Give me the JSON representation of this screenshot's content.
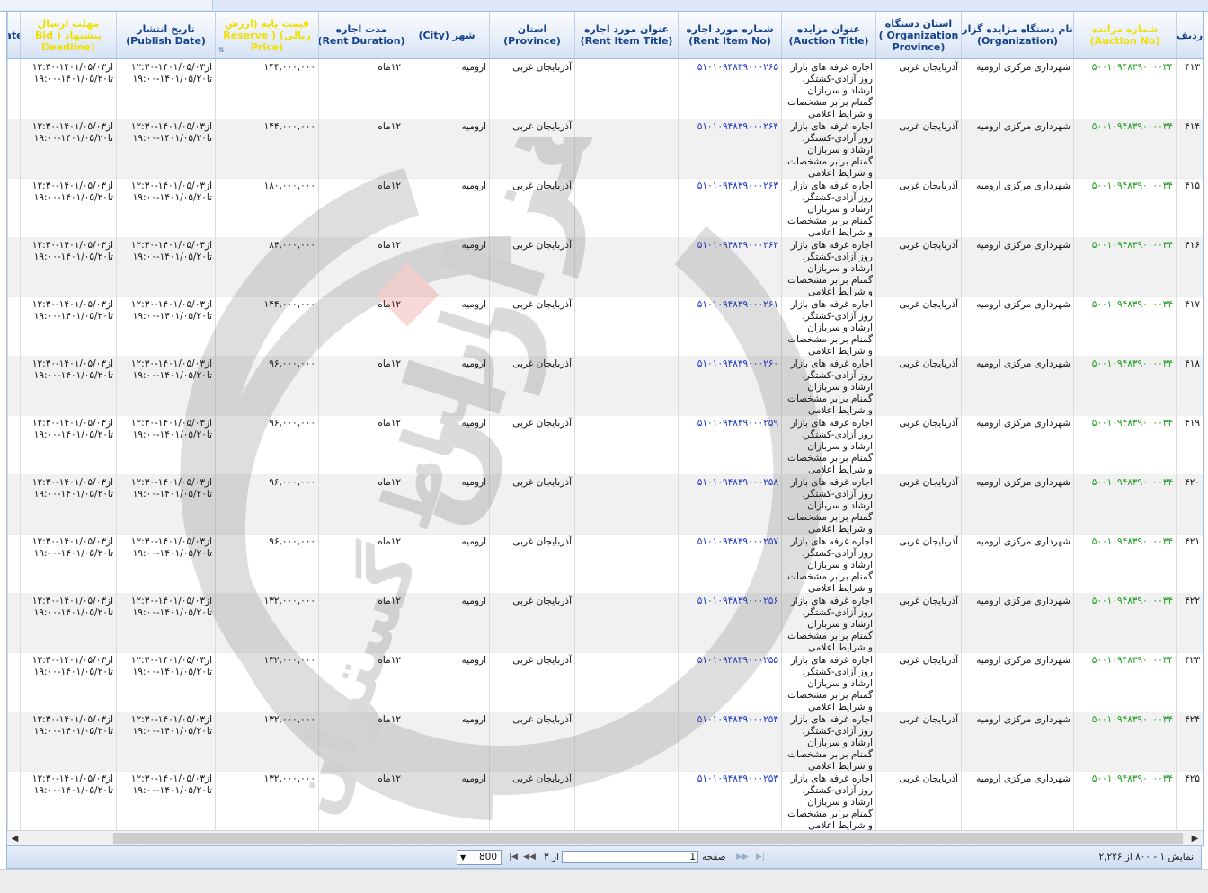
{
  "headers": [
    {
      "key": "idx",
      "lines": [
        "ردیف"
      ],
      "hl": false
    },
    {
      "key": "auction_no",
      "lines": [
        "شماره مزایده",
        "(Auction No)"
      ],
      "hl": true
    },
    {
      "key": "organization",
      "lines": [
        "نام دستگاه مزایده گزار",
        "(Organization)"
      ],
      "hl": false
    },
    {
      "key": "org_province",
      "lines": [
        "استان دستگاه",
        "Organization )",
        "(Province"
      ],
      "hl": false
    },
    {
      "key": "auction_title",
      "lines": [
        "عنوان مزایده",
        "(Auction Title)"
      ],
      "hl": false
    },
    {
      "key": "rent_item_no",
      "lines": [
        "شماره مورد اجاره",
        "(Rent Item No)"
      ],
      "hl": false
    },
    {
      "key": "rent_item_title",
      "lines": [
        "عنوان مورد اجاره",
        "(Rent Item Title)"
      ],
      "hl": false
    },
    {
      "key": "province",
      "lines": [
        "استان",
        "(Province)"
      ],
      "hl": false
    },
    {
      "key": "city",
      "lines": [
        "شهر (City)"
      ],
      "hl": false
    },
    {
      "key": "rent_duration",
      "lines": [
        "مدت اجاره",
        "(Rent Duration)"
      ],
      "hl": false
    },
    {
      "key": "reserve_price",
      "lines": [
        "قیمت پایه (ارزش",
        "ریالی) ( Reserve",
        "(Price"
      ],
      "hl": true
    },
    {
      "key": "publish_date",
      "lines": [
        "تاریخ انتشار",
        "(Publish Date)"
      ],
      "hl": false
    },
    {
      "key": "deadline",
      "lines": [
        "مهلت ارسال",
        "پیشنهاد ( Bid",
        "(Deadline"
      ],
      "hl": true
    },
    {
      "key": "extra",
      "lines": [
        "ate"
      ],
      "hl": false
    }
  ],
  "rows": [
    {
      "idx": "۴۱۳",
      "auction_no": "۵۰۰۱۰۹۴۸۳۹۰۰۰۰۳۴",
      "organization": "شهرداری مرکزی ارومیه",
      "org_province": "آذربایجان غربی",
      "auction_title": "اجاره غرفه های بازار روز آزادی-کشتگر، ارشاد و سربازان گمنام برابر مشخصات و شرایط اعلامی",
      "rent_item_no": "۵۱۰۱۰۹۴۸۳۹۰۰۰۲۶۵",
      "rent_item_title": "",
      "province": "آذربایجان غربی",
      "city": "ارومیه",
      "rent_duration": "۱۲ماه",
      "reserve_price": "۱۴۴,۰۰۰,۰۰۰",
      "publish_date": [
        "از۱۴۰۱/۰۵/۰۳-۱۲:۳۰",
        "تا۱۴۰۱/۰۵/۲۰-۱۹:۰۰"
      ],
      "deadline": [
        "از۱۴۰۱/۰۵/۰۳-۱۲:۳۰",
        "تا۱۴۰۱/۰۵/۲۰-۱۹:۰۰"
      ]
    },
    {
      "idx": "۴۱۴",
      "auction_no": "۵۰۰۱۰۹۴۸۳۹۰۰۰۰۳۴",
      "organization": "شهرداری مرکزی ارومیه",
      "org_province": "آذربایجان غربی",
      "auction_title": "اجاره غرفه های بازار روز آزادی-کشتگر، ارشاد و سربازان گمنام برابر مشخصات و شرایط اعلامی",
      "rent_item_no": "۵۱۰۱۰۹۴۸۳۹۰۰۰۲۶۴",
      "rent_item_title": "",
      "province": "آذربایجان غربی",
      "city": "ارومیه",
      "rent_duration": "۱۲ماه",
      "reserve_price": "۱۴۴,۰۰۰,۰۰۰",
      "publish_date": [
        "از۱۴۰۱/۰۵/۰۳-۱۲:۳۰",
        "تا۱۴۰۱/۰۵/۲۰-۱۹:۰۰"
      ],
      "deadline": [
        "از۱۴۰۱/۰۵/۰۳-۱۲:۳۰",
        "تا۱۴۰۱/۰۵/۲۰-۱۹:۰۰"
      ]
    },
    {
      "idx": "۴۱۵",
      "auction_no": "۵۰۰۱۰۹۴۸۳۹۰۰۰۰۳۴",
      "organization": "شهرداری مرکزی ارومیه",
      "org_province": "آذربایجان غربی",
      "auction_title": "اجاره غرفه های بازار روز آزادی-کشتگر، ارشاد و سربازان گمنام برابر مشخصات و شرایط اعلامی",
      "rent_item_no": "۵۱۰۱۰۹۴۸۳۹۰۰۰۲۶۳",
      "rent_item_title": "",
      "province": "آذربایجان غربی",
      "city": "ارومیه",
      "rent_duration": "۱۲ماه",
      "reserve_price": "۱۸۰,۰۰۰,۰۰۰",
      "publish_date": [
        "از۱۴۰۱/۰۵/۰۳-۱۲:۳۰",
        "تا۱۴۰۱/۰۵/۲۰-۱۹:۰۰"
      ],
      "deadline": [
        "از۱۴۰۱/۰۵/۰۳-۱۲:۳۰",
        "تا۱۴۰۱/۰۵/۲۰-۱۹:۰۰"
      ]
    },
    {
      "idx": "۴۱۶",
      "auction_no": "۵۰۰۱۰۹۴۸۳۹۰۰۰۰۳۴",
      "organization": "شهرداری مرکزی ارومیه",
      "org_province": "آذربایجان غربی",
      "auction_title": "اجاره غرفه های بازار روز آزادی-کشتگر، ارشاد و سربازان گمنام برابر مشخصات و شرایط اعلامی",
      "rent_item_no": "۵۱۰۱۰۹۴۸۳۹۰۰۰۲۶۲",
      "rent_item_title": "",
      "province": "آذربایجان غربی",
      "city": "ارومیه",
      "rent_duration": "۱۲ماه",
      "reserve_price": "۸۴,۰۰۰,۰۰۰",
      "publish_date": [
        "از۱۴۰۱/۰۵/۰۳-۱۲:۳۰",
        "تا۱۴۰۱/۰۵/۲۰-۱۹:۰۰"
      ],
      "deadline": [
        "از۱۴۰۱/۰۵/۰۳-۱۲:۳۰",
        "تا۱۴۰۱/۰۵/۲۰-۱۹:۰۰"
      ]
    },
    {
      "idx": "۴۱۷",
      "auction_no": "۵۰۰۱۰۹۴۸۳۹۰۰۰۰۳۴",
      "organization": "شهرداری مرکزی ارومیه",
      "org_province": "آذربایجان غربی",
      "auction_title": "اجاره غرفه های بازار روز آزادی-کشتگر، ارشاد و سربازان گمنام برابر مشخصات و شرایط اعلامی",
      "rent_item_no": "۵۱۰۱۰۹۴۸۳۹۰۰۰۲۶۱",
      "rent_item_title": "",
      "province": "آذربایجان غربی",
      "city": "ارومیه",
      "rent_duration": "۱۲ماه",
      "reserve_price": "۱۴۴,۰۰۰,۰۰۰",
      "publish_date": [
        "از۱۴۰۱/۰۵/۰۳-۱۲:۳۰",
        "تا۱۴۰۱/۰۵/۲۰-۱۹:۰۰"
      ],
      "deadline": [
        "از۱۴۰۱/۰۵/۰۳-۱۲:۳۰",
        "تا۱۴۰۱/۰۵/۲۰-۱۹:۰۰"
      ]
    },
    {
      "idx": "۴۱۸",
      "auction_no": "۵۰۰۱۰۹۴۸۳۹۰۰۰۰۳۴",
      "organization": "شهرداری مرکزی ارومیه",
      "org_province": "آذربایجان غربی",
      "auction_title": "اجاره غرفه های بازار روز آزادی-کشتگر، ارشاد و سربازان گمنام برابر مشخصات و شرایط اعلامی",
      "rent_item_no": "۵۱۰۱۰۹۴۸۳۹۰۰۰۲۶۰",
      "rent_item_title": "",
      "province": "آذربایجان غربی",
      "city": "ارومیه",
      "rent_duration": "۱۲ماه",
      "reserve_price": "۹۶,۰۰۰,۰۰۰",
      "publish_date": [
        "از۱۴۰۱/۰۵/۰۳-۱۲:۳۰",
        "تا۱۴۰۱/۰۵/۲۰-۱۹:۰۰"
      ],
      "deadline": [
        "از۱۴۰۱/۰۵/۰۳-۱۲:۳۰",
        "تا۱۴۰۱/۰۵/۲۰-۱۹:۰۰"
      ]
    },
    {
      "idx": "۴۱۹",
      "auction_no": "۵۰۰۱۰۹۴۸۳۹۰۰۰۰۳۴",
      "organization": "شهرداری مرکزی ارومیه",
      "org_province": "آذربایجان غربی",
      "auction_title": "اجاره غرفه های بازار روز آزادی-کشتگر، ارشاد و سربازان گمنام برابر مشخصات و شرایط اعلامی",
      "rent_item_no": "۵۱۰۱۰۹۴۸۳۹۰۰۰۲۵۹",
      "rent_item_title": "",
      "province": "آذربایجان غربی",
      "city": "ارومیه",
      "rent_duration": "۱۲ماه",
      "reserve_price": "۹۶,۰۰۰,۰۰۰",
      "publish_date": [
        "از۱۴۰۱/۰۵/۰۳-۱۲:۳۰",
        "تا۱۴۰۱/۰۵/۲۰-۱۹:۰۰"
      ],
      "deadline": [
        "از۱۴۰۱/۰۵/۰۳-۱۲:۳۰",
        "تا۱۴۰۱/۰۵/۲۰-۱۹:۰۰"
      ]
    },
    {
      "idx": "۴۲۰",
      "auction_no": "۵۰۰۱۰۹۴۸۳۹۰۰۰۰۳۴",
      "organization": "شهرداری مرکزی ارومیه",
      "org_province": "آذربایجان غربی",
      "auction_title": "اجاره غرفه های بازار روز آزادی-کشتگر، ارشاد و سربازان گمنام برابر مشخصات و شرایط اعلامی",
      "rent_item_no": "۵۱۰۱۰۹۴۸۳۹۰۰۰۲۵۸",
      "rent_item_title": "",
      "province": "آذربایجان غربی",
      "city": "ارومیه",
      "rent_duration": "۱۲ماه",
      "reserve_price": "۹۶,۰۰۰,۰۰۰",
      "publish_date": [
        "از۱۴۰۱/۰۵/۰۳-۱۲:۳۰",
        "تا۱۴۰۱/۰۵/۲۰-۱۹:۰۰"
      ],
      "deadline": [
        "از۱۴۰۱/۰۵/۰۳-۱۲:۳۰",
        "تا۱۴۰۱/۰۵/۲۰-۱۹:۰۰"
      ]
    },
    {
      "idx": "۴۲۱",
      "auction_no": "۵۰۰۱۰۹۴۸۳۹۰۰۰۰۳۴",
      "organization": "شهرداری مرکزی ارومیه",
      "org_province": "آذربایجان غربی",
      "auction_title": "اجاره غرفه های بازار روز آزادی-کشتگر، ارشاد و سربازان گمنام برابر مشخصات و شرایط اعلامی",
      "rent_item_no": "۵۱۰۱۰۹۴۸۳۹۰۰۰۲۵۷",
      "rent_item_title": "",
      "province": "آذربایجان غربی",
      "city": "ارومیه",
      "rent_duration": "۱۲ماه",
      "reserve_price": "۹۶,۰۰۰,۰۰۰",
      "publish_date": [
        "از۱۴۰۱/۰۵/۰۳-۱۲:۳۰",
        "تا۱۴۰۱/۰۵/۲۰-۱۹:۰۰"
      ],
      "deadline": [
        "از۱۴۰۱/۰۵/۰۳-۱۲:۳۰",
        "تا۱۴۰۱/۰۵/۲۰-۱۹:۰۰"
      ]
    },
    {
      "idx": "۴۲۲",
      "auction_no": "۵۰۰۱۰۹۴۸۳۹۰۰۰۰۳۴",
      "organization": "شهرداری مرکزی ارومیه",
      "org_province": "آذربایجان غربی",
      "auction_title": "اجاره غرفه های بازار روز آزادی-کشتگر، ارشاد و سربازان گمنام برابر مشخصات و شرایط اعلامی",
      "rent_item_no": "۵۱۰۱۰۹۴۸۳۹۰۰۰۲۵۶",
      "rent_item_title": "",
      "province": "آذربایجان غربی",
      "city": "ارومیه",
      "rent_duration": "۱۲ماه",
      "reserve_price": "۱۳۲,۰۰۰,۰۰۰",
      "publish_date": [
        "از۱۴۰۱/۰۵/۰۳-۱۲:۳۰",
        "تا۱۴۰۱/۰۵/۲۰-۱۹:۰۰"
      ],
      "deadline": [
        "از۱۴۰۱/۰۵/۰۳-۱۲:۳۰",
        "تا۱۴۰۱/۰۵/۲۰-۱۹:۰۰"
      ]
    },
    {
      "idx": "۴۲۳",
      "auction_no": "۵۰۰۱۰۹۴۸۳۹۰۰۰۰۳۴",
      "organization": "شهرداری مرکزی ارومیه",
      "org_province": "آذربایجان غربی",
      "auction_title": "اجاره غرفه های بازار روز آزادی-کشتگر، ارشاد و سربازان گمنام برابر مشخصات و شرایط اعلامی",
      "rent_item_no": "۵۱۰۱۰۹۴۸۳۹۰۰۰۲۵۵",
      "rent_item_title": "",
      "province": "آذربایجان غربی",
      "city": "ارومیه",
      "rent_duration": "۱۲ماه",
      "reserve_price": "۱۳۲,۰۰۰,۰۰۰",
      "publish_date": [
        "از۱۴۰۱/۰۵/۰۳-۱۲:۳۰",
        "تا۱۴۰۱/۰۵/۲۰-۱۹:۰۰"
      ],
      "deadline": [
        "از۱۴۰۱/۰۵/۰۳-۱۲:۳۰",
        "تا۱۴۰۱/۰۵/۲۰-۱۹:۰۰"
      ]
    },
    {
      "idx": "۴۲۴",
      "auction_no": "۵۰۰۱۰۹۴۸۳۹۰۰۰۰۳۴",
      "organization": "شهرداری مرکزی ارومیه",
      "org_province": "آذربایجان غربی",
      "auction_title": "اجاره غرفه های بازار روز آزادی-کشتگر، ارشاد و سربازان گمنام برابر مشخصات و شرایط اعلامی",
      "rent_item_no": "۵۱۰۱۰۹۴۸۳۹۰۰۰۲۵۴",
      "rent_item_title": "",
      "province": "آذربایجان غربی",
      "city": "ارومیه",
      "rent_duration": "۱۲ماه",
      "reserve_price": "۱۳۲,۰۰۰,۰۰۰",
      "publish_date": [
        "از۱۴۰۱/۰۵/۰۳-۱۲:۳۰",
        "تا۱۴۰۱/۰۵/۲۰-۱۹:۰۰"
      ],
      "deadline": [
        "از۱۴۰۱/۰۵/۰۳-۱۲:۳۰",
        "تا۱۴۰۱/۰۵/۲۰-۱۹:۰۰"
      ]
    },
    {
      "idx": "۴۲۵",
      "auction_no": "۵۰۰۱۰۹۴۸۳۹۰۰۰۰۳۴",
      "organization": "شهرداری مرکزی ارومیه",
      "org_province": "آذربایجان غربی",
      "auction_title": "اجاره غرفه های بازار روز آزادی-کشتگر، ارشاد و سربازان گمنام برابر مشخصات و شرایط اعلامی",
      "rent_item_no": "۵۱۰۱۰۹۴۸۳۹۰۰۰۲۵۳",
      "rent_item_title": "",
      "province": "آذربایجان غربی",
      "city": "ارومیه",
      "rent_duration": "۱۲ماه",
      "reserve_price": "۱۳۲,۰۰۰,۰۰۰",
      "publish_date": [
        "از۱۴۰۱/۰۵/۰۳-۱۲:۳۰",
        "تا۱۴۰۱/۰۵/۲۰-۱۹:۰۰"
      ],
      "deadline": [
        "از۱۴۰۱/۰۵/۰۳-۱۲:۳۰",
        "تا۱۴۰۱/۰۵/۲۰-۱۹:۰۰"
      ]
    }
  ],
  "pager": {
    "display_text": "نمایش ۱ - ۸۰۰ از ۲,۲۲۶",
    "page_label": "صفحه",
    "page_value": "1",
    "of_label": "از ۳",
    "page_size": "800"
  },
  "watermark": {
    "text_main": "هزاران",
    "text_sub": "ارتباط گستران",
    "accent_color": "#e02020"
  },
  "colors": {
    "header_text": "#15428b",
    "header_highlight": "#f0e000",
    "auction_no": "#1a9a1a",
    "rent_item_no": "#1a35c8",
    "border": "#99bbe8"
  },
  "icons": {
    "sort": "sort-arrow-icon",
    "scroll_left": "scroll-left-arrow-icon",
    "scroll_right": "scroll-right-arrow-icon",
    "first_page": "first-page-icon",
    "prev_page": "prev-page-icon",
    "next_page": "next-page-icon",
    "last_page": "last-page-icon",
    "dropdown": "dropdown-caret-icon"
  }
}
